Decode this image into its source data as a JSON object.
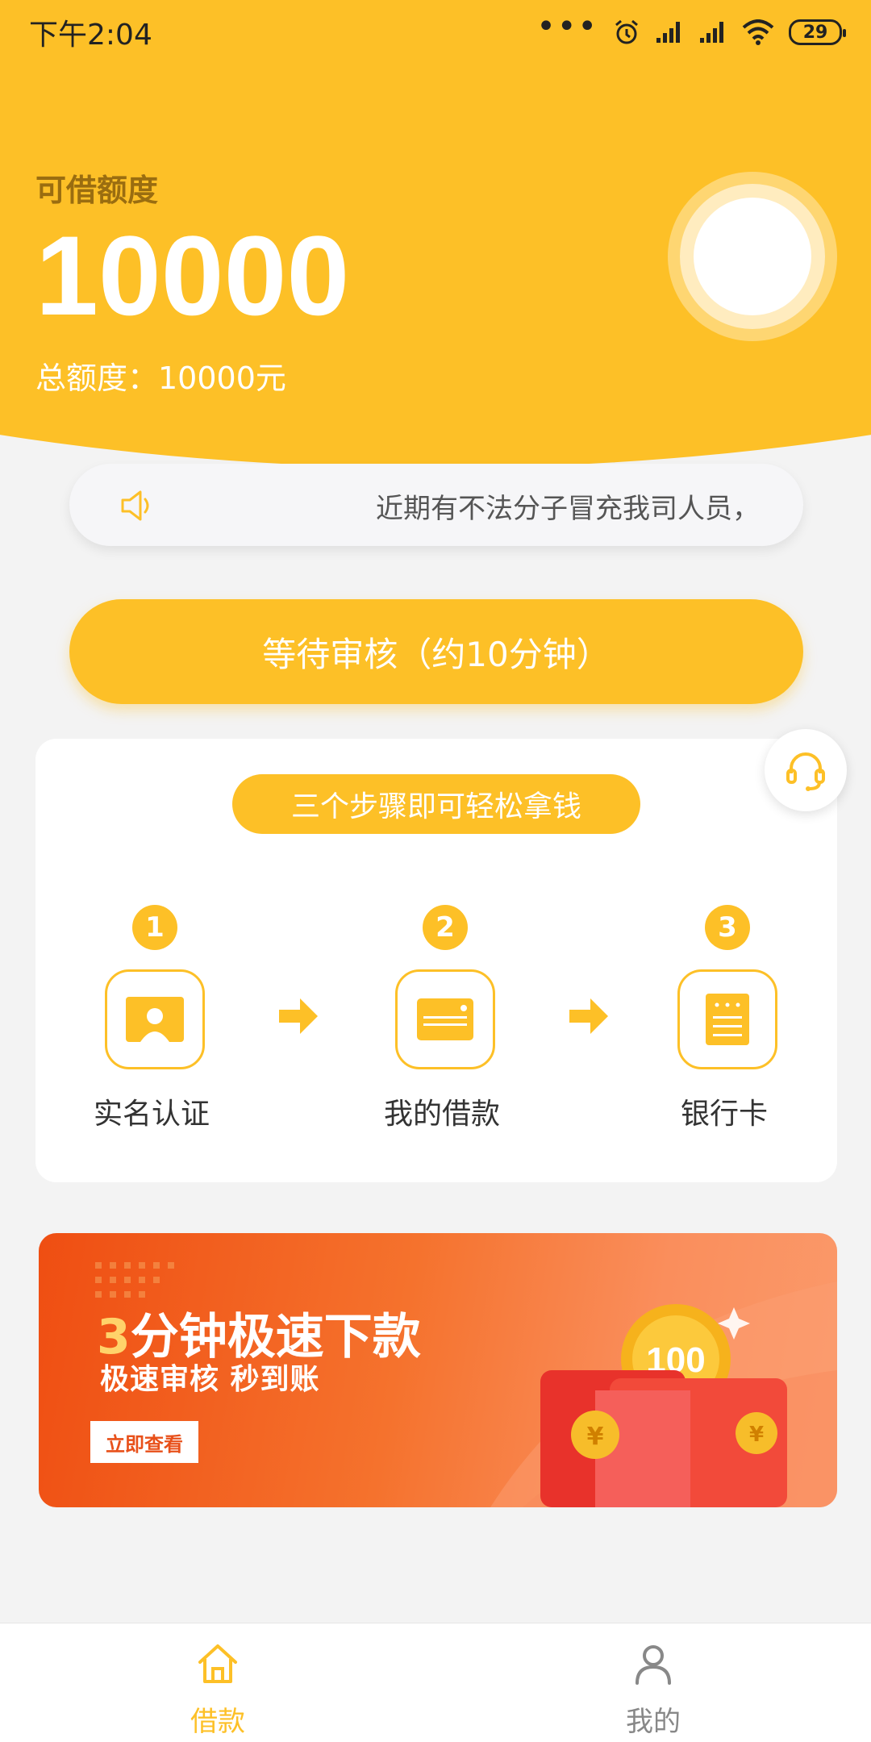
{
  "status_bar": {
    "time": "下午2:04",
    "battery": "29",
    "icons": [
      "more-dots-icon",
      "alarm-icon",
      "signal-icon",
      "signal-icon",
      "wifi-icon",
      "battery-icon"
    ]
  },
  "header": {
    "limit_label": "可借额度",
    "limit_amount": "10000",
    "total_text": "总额度：10000元"
  },
  "notice": {
    "icon": "speaker-icon",
    "text": "近期有不法分子冒充我司人员，"
  },
  "apply_button": {
    "label": "等待审核（约10分钟）"
  },
  "steps": {
    "title": "三个步骤即可轻松拿钱",
    "items": [
      {
        "number": "1",
        "label": "实名认证",
        "icon": "id-card-icon"
      },
      {
        "number": "2",
        "label": "我的借款",
        "icon": "credit-card-icon"
      },
      {
        "number": "3",
        "label": "银行卡",
        "icon": "document-icon"
      }
    ]
  },
  "support": {
    "icon": "headset-icon"
  },
  "banner": {
    "title_num": "3",
    "title_rest": "分钟极速下款",
    "subtitle": "极速审核  秒到账",
    "button": "立即查看",
    "coin_value": "100",
    "coin_symbol": "¥"
  },
  "tabbar": {
    "items": [
      {
        "label": "借款",
        "icon": "home-icon",
        "active": true
      },
      {
        "label": "我的",
        "icon": "user-icon",
        "active": false
      }
    ]
  },
  "colors": {
    "accent": "#fdc027",
    "inactive": "#888888",
    "banner_start": "#ef4e12",
    "banner_end": "#fb9a6b"
  }
}
